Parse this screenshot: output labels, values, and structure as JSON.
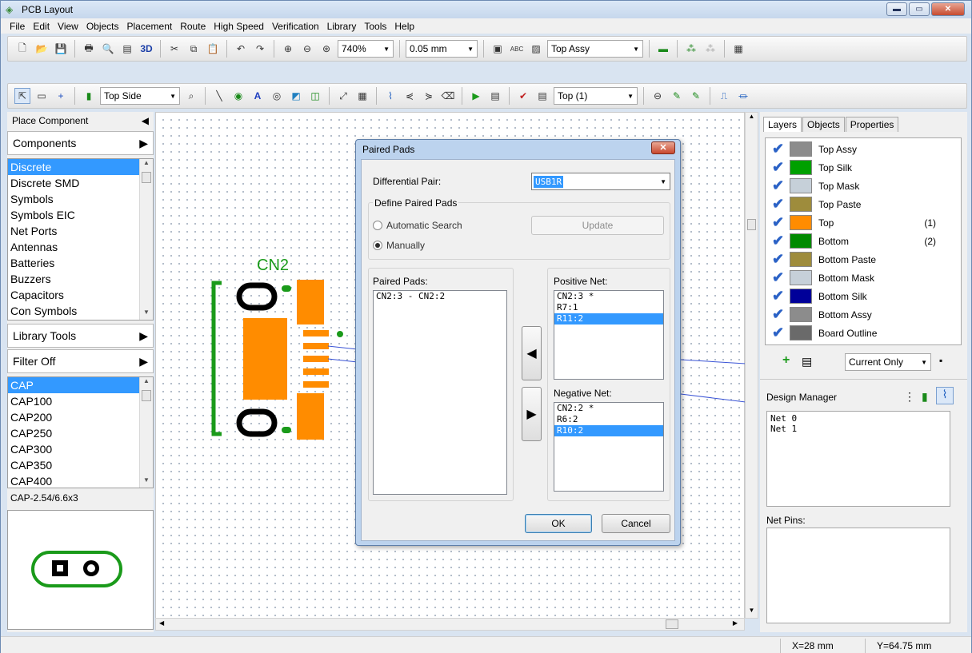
{
  "window": {
    "title": "PCB Layout"
  },
  "menu": [
    "File",
    "Edit",
    "View",
    "Objects",
    "Placement",
    "Route",
    "High Speed",
    "Verification",
    "Library",
    "Tools",
    "Help"
  ],
  "toolbar1": {
    "label_3d": "3D",
    "zoom": "740%",
    "grid": "0.05 mm",
    "abc": "ABC",
    "layer_assy": "Top Assy"
  },
  "toolbar2": {
    "side": "Top Side",
    "layer": "Top (1)"
  },
  "left_panel": {
    "place_component": "Place Component",
    "components_header": "Components",
    "components": [
      "Discrete",
      "Discrete SMD",
      "Symbols",
      "Symbols EIC",
      "Net Ports",
      "Antennas",
      "Batteries",
      "Buzzers",
      "Capacitors",
      "Con Symbols"
    ],
    "library_tools": "Library Tools",
    "filter": "Filter Off",
    "parts": [
      "CAP",
      "CAP100",
      "CAP200",
      "CAP250",
      "CAP300",
      "CAP350",
      "CAP400"
    ],
    "pattern_name": "CAP-2.54/6.6x3"
  },
  "canvas": {
    "component_ref": "CN2"
  },
  "right_panel": {
    "tabs": [
      "Layers",
      "Objects",
      "Properties"
    ],
    "layers": [
      {
        "name": "Top Assy",
        "color": "#8c8c8c",
        "count": ""
      },
      {
        "name": "Top Silk",
        "color": "#00a000",
        "count": ""
      },
      {
        "name": "Top Mask",
        "color": "#c6d0d9",
        "count": ""
      },
      {
        "name": "Top Paste",
        "color": "#9e8c3c",
        "count": ""
      },
      {
        "name": "Top",
        "color": "#ff8c00",
        "count": "(1)"
      },
      {
        "name": "Bottom",
        "color": "#008a00",
        "count": "(2)"
      },
      {
        "name": "Bottom Paste",
        "color": "#9e8c3c",
        "count": ""
      },
      {
        "name": "Bottom Mask",
        "color": "#c6d0d9",
        "count": ""
      },
      {
        "name": "Bottom Silk",
        "color": "#000099",
        "count": ""
      },
      {
        "name": "Bottom Assy",
        "color": "#8c8c8c",
        "count": ""
      },
      {
        "name": "Board Outline",
        "color": "#6a6a6a",
        "count": ""
      }
    ],
    "current_only": "Current Only",
    "design_manager": "Design Manager",
    "nets": [
      "Net 0",
      "Net 1"
    ],
    "net_pins": "Net Pins:"
  },
  "dialog": {
    "title": "Paired Pads",
    "differential_pair_label": "Differential Pair:",
    "differential_pair_value": "USB1R",
    "define_group": "Define Paired Pads",
    "automatic_search": "Automatic Search",
    "manually": "Manually",
    "update": "Update",
    "paired_pads_label": "Paired Pads:",
    "paired_pads": [
      "CN2:3 - CN2:2"
    ],
    "positive_label": "Positive Net:",
    "positive_net": [
      "CN2:3 *",
      "R7:1",
      "R11:2"
    ],
    "negative_label": "Negative Net:",
    "negative_net": [
      "CN2:2 *",
      "R6:2",
      "R10:2"
    ],
    "ok": "OK",
    "cancel": "Cancel"
  },
  "status": {
    "x": "X=28 mm",
    "y": "Y=64.75 mm"
  }
}
